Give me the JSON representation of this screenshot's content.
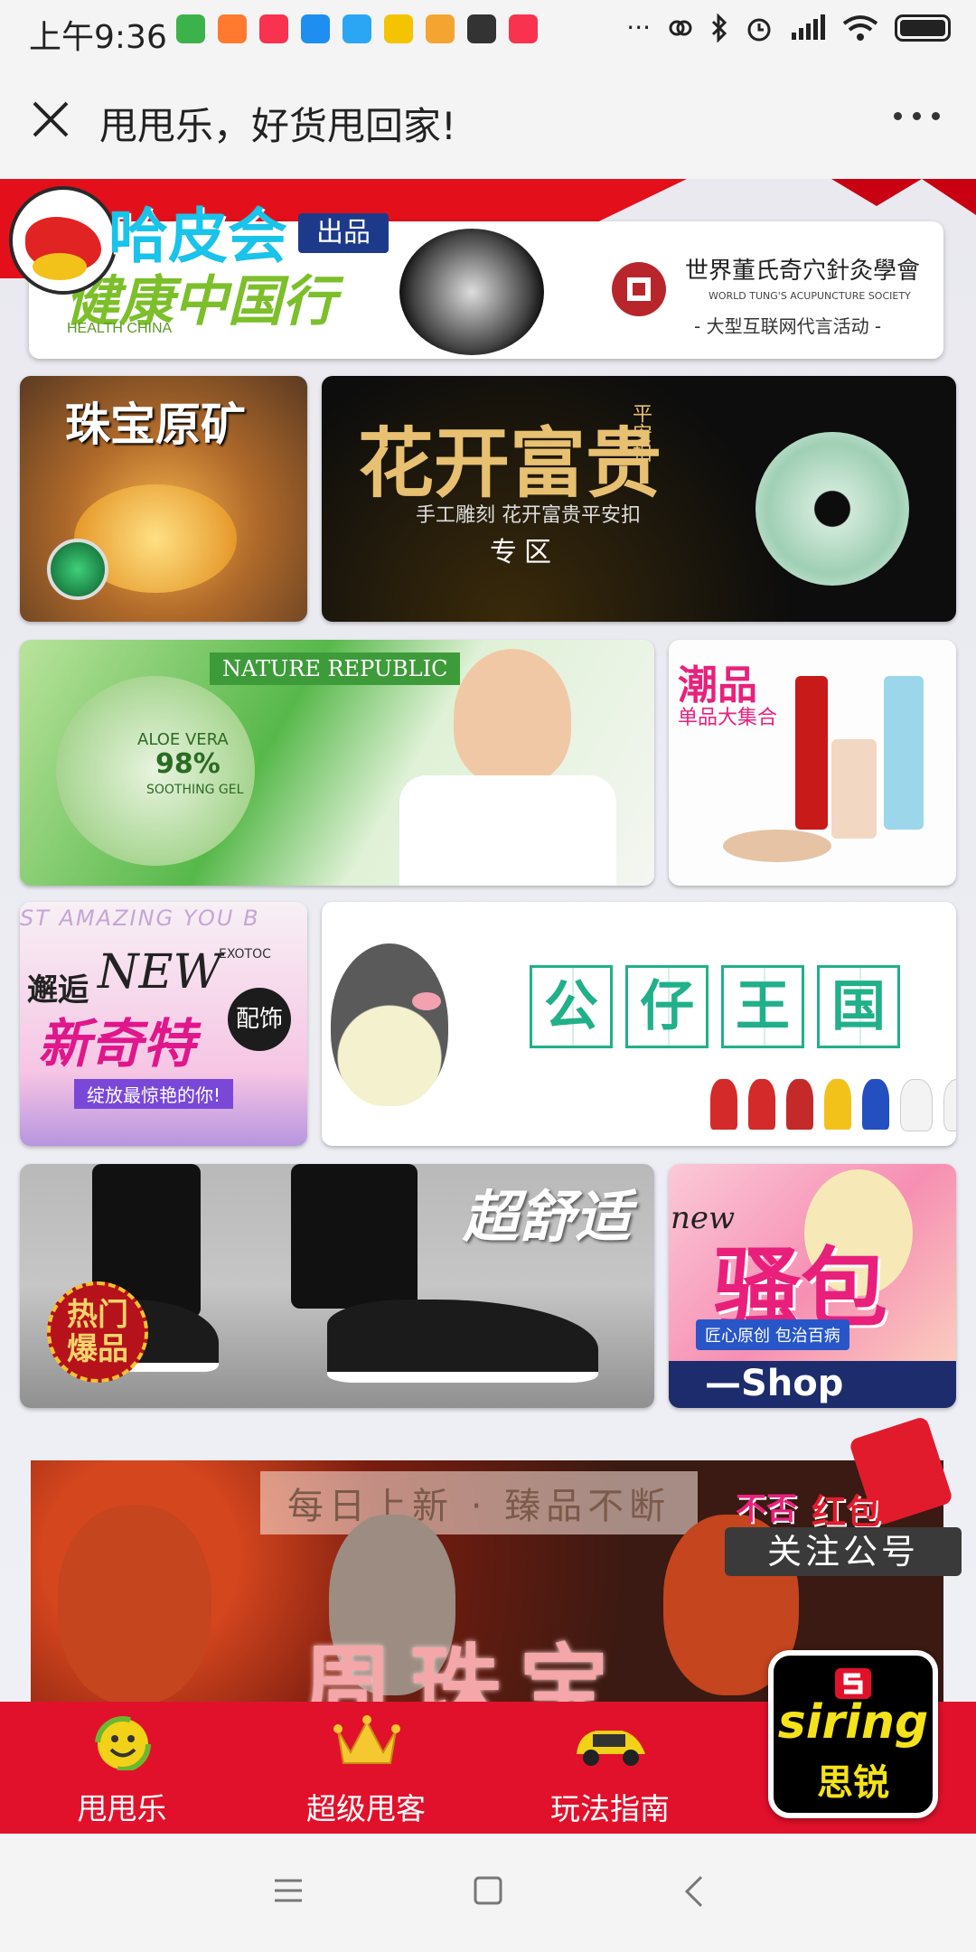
{
  "status_bar": {
    "time": "上午9:36",
    "apps": [
      {
        "icon": "wechat-app-icon",
        "color": "#3cb34a"
      },
      {
        "icon": "calendar-app-icon",
        "color": "#ff7a2e"
      },
      {
        "icon": "video-app-icon",
        "color": "#f8324f"
      },
      {
        "icon": "arrow-app-icon",
        "color": "#1e8ef0"
      },
      {
        "icon": "bird-app-icon",
        "color": "#2aa6f4"
      },
      {
        "icon": "chat-app-icon",
        "color": "#f5c400"
      },
      {
        "icon": "face-app-icon",
        "color": "#f4a531"
      },
      {
        "icon": "cup-app-icon",
        "color": "#333333"
      },
      {
        "icon": "video2-app-icon",
        "color": "#f8324f"
      }
    ],
    "overflow": "···"
  },
  "title_bar": {
    "title": "甩甩乐，好货甩回家!"
  },
  "hero": {
    "logo_title": "哈皮会",
    "badge": "出品",
    "health_text": "健康中国行",
    "health_sub": "HEALTH CHINA",
    "society_name": "世界董氏奇穴針灸學會",
    "society_en": "WORLD TUNG'S ACUPUNCTURE SOCIETY",
    "society_sub": "- 大型互联网代言活动 -"
  },
  "banners": {
    "jewelry": {
      "title": "珠宝原矿"
    },
    "jade": {
      "title": "花开富贵",
      "side": "平安扣",
      "subtitle": "手工雕刻  花开富贵平安扣",
      "zone": "专区"
    },
    "nature": {
      "label": "NATURE REPUBLIC",
      "product": "ALOE VERA",
      "percent": "98%",
      "gel": "SOOTHING GEL"
    },
    "trend": {
      "title": "潮品",
      "subtitle": "单品大集合"
    },
    "accessory": {
      "top": "邂逅",
      "new": "NEW",
      "brand": "EXOTOC",
      "main": "新奇特",
      "tag": "配饰",
      "slogan": "绽放最惊艳的你!",
      "bg_text": "ST AMAZING YOU B"
    },
    "doll": {
      "chars": [
        "公",
        "仔",
        "王",
        "国"
      ]
    },
    "shoes": {
      "title": "超舒适",
      "badge_top": "热门",
      "badge_bottom": "爆品"
    },
    "sexy": {
      "new": "new",
      "title": "骚包",
      "tag": "匠心原创 包治百病",
      "shop": "—Shop"
    },
    "beads": {
      "slogan": "每日上新 · 臻品不断",
      "title": "周珠宝"
    },
    "follow": {
      "hongbao": "红包",
      "prefix": "不否",
      "label": "关注公号"
    }
  },
  "bottom_nav": {
    "items": [
      {
        "label": "甩甩乐",
        "icon": "smiley-icon"
      },
      {
        "label": "超级甩客",
        "icon": "crown-icon"
      },
      {
        "label": "玩法指南",
        "icon": "car-icon"
      }
    ],
    "logo_en": "siring",
    "logo_cn": "思锐"
  },
  "colors": {
    "primary_red": "#e2112b",
    "cyan": "#19c3ea",
    "teal": "#20b08a"
  }
}
